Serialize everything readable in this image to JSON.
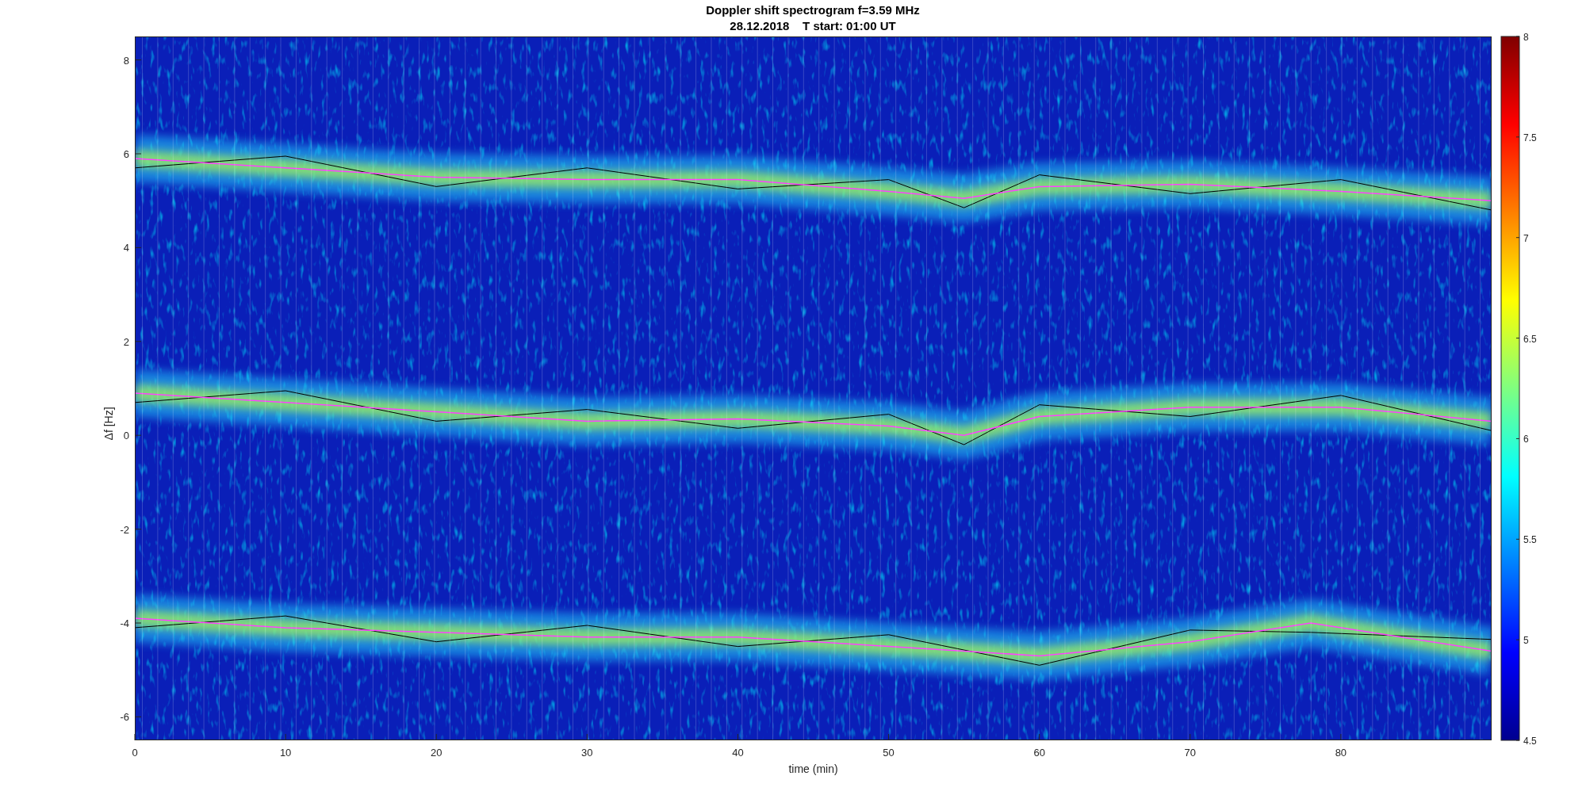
{
  "title": [
    "Doppler shift spectrogram f=3.59 MHz",
    "28.12.2018    T start: 01:00 UT"
  ],
  "x_axis": {
    "label": "time (min)",
    "ticks": [
      "0",
      "10",
      "20",
      "30",
      "40",
      "50",
      "60",
      "70",
      "80"
    ]
  },
  "y_axis": {
    "label": "Δf [Hz]",
    "ticks": [
      "8",
      "6",
      "4",
      "2",
      "0",
      "-2",
      "-4",
      "-6"
    ]
  },
  "colorbar": {
    "ticks": [
      "8",
      "7.5",
      "7",
      "6.5",
      "6",
      "5.5",
      "5",
      "4.5"
    ]
  }
}
